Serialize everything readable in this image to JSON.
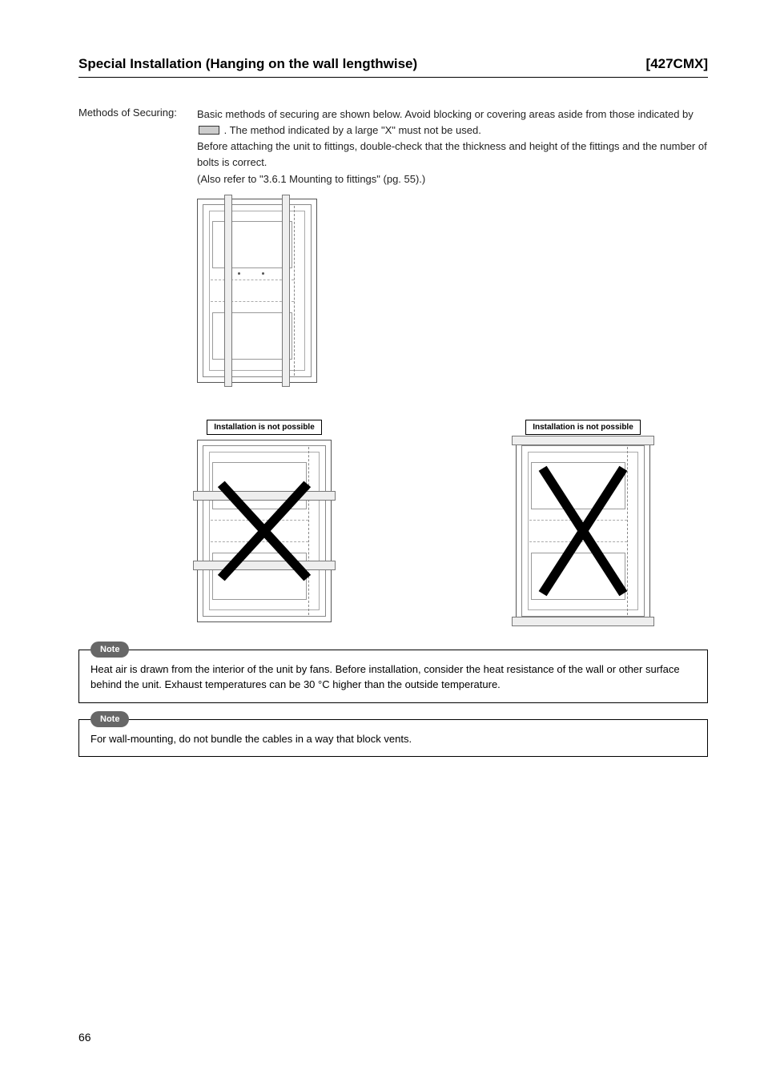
{
  "header": {
    "title": "Special Installation (Hanging on the wall lengthwise)",
    "model": "[427CMX]"
  },
  "body": {
    "label": "Methods of Securing:",
    "para1a": "Basic methods of securing are shown below. Avoid blocking or covering areas aside from those indicated by ",
    "para1b": " . The method indicated by a large \"X\" must not be used.",
    "para2": "Before attaching the unit to fittings, double-check that the thickness and height of the fittings and the number of bolts is correct.",
    "para3": "(Also refer to \"3.6.1 Mounting to fittings\" (pg. 55).)"
  },
  "captions": {
    "left": "Installation is not possible",
    "right": "Installation is not possible"
  },
  "notes": {
    "label": "Note",
    "n1": "Heat air is drawn from the interior of the unit by fans. Before installation, consider the heat resistance of the wall or other surface behind the unit. Exhaust temperatures can be 30 °C higher than the outside temperature.",
    "n2": "For wall-mounting, do not bundle the cables in a way that block vents."
  },
  "pageNumber": "66"
}
